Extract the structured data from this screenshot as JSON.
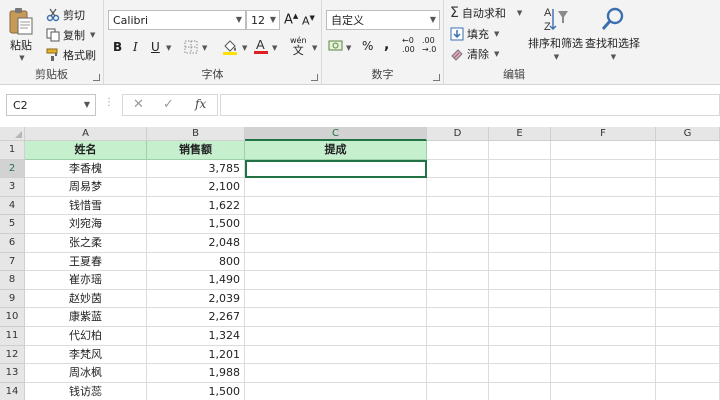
{
  "clipboard": {
    "group_label": "剪贴板",
    "paste_label": "粘贴",
    "cut_label": "剪切",
    "copy_label": "复制",
    "format_painter_label": "格式刷"
  },
  "font": {
    "group_label": "字体",
    "font_name": "Calibri",
    "font_size": "12",
    "bold": "B",
    "italic": "I",
    "underline": "U",
    "grow": "A",
    "shrink": "A",
    "phonetic_top": "wén",
    "phonetic_bottom": "文"
  },
  "number": {
    "group_label": "数字",
    "format": "自定义",
    "percent": "%",
    "comma": ",",
    "inc_decimal_top": "←0",
    "inc_decimal_bottom": ".00",
    "dec_decimal_top": ".00",
    "dec_decimal_bottom": "→.0"
  },
  "editing": {
    "group_label": "编辑",
    "autosum_label": "自动求和",
    "fill_label": "填充",
    "clear_label": "清除",
    "sort_filter_label": "排序和筛选",
    "find_select_label": "查找和选择"
  },
  "formula_bar": {
    "name_box": "C2",
    "cancel": "✕",
    "enter": "✓",
    "fx": "fx",
    "value": ""
  },
  "sheet": {
    "columns": [
      "A",
      "B",
      "C",
      "D",
      "E",
      "F",
      "G"
    ],
    "selected_column": "C",
    "selected_row": "2",
    "header_row": [
      "姓名",
      "销售额",
      "提成"
    ],
    "rows": [
      {
        "row": "2",
        "name": "李香槐",
        "sales": "3,785"
      },
      {
        "row": "3",
        "name": "周易梦",
        "sales": "2,100"
      },
      {
        "row": "4",
        "name": "钱惜雪",
        "sales": "1,622"
      },
      {
        "row": "5",
        "name": "刘宛海",
        "sales": "1,500"
      },
      {
        "row": "6",
        "name": "张之柔",
        "sales": "2,048"
      },
      {
        "row": "7",
        "name": "王夏春",
        "sales": "800"
      },
      {
        "row": "8",
        "name": "崔亦瑶",
        "sales": "1,490"
      },
      {
        "row": "9",
        "name": "赵妙茵",
        "sales": "2,039"
      },
      {
        "row": "10",
        "name": "康紫蓝",
        "sales": "2,267"
      },
      {
        "row": "11",
        "name": "代幻柏",
        "sales": "1,324"
      },
      {
        "row": "12",
        "name": "李梵风",
        "sales": "1,201"
      },
      {
        "row": "13",
        "name": "周冰枫",
        "sales": "1,988"
      },
      {
        "row": "14",
        "name": "钱访蕊",
        "sales": "1,500"
      }
    ]
  },
  "colors": {
    "header_fill": "#c6efce",
    "accent": "#217346"
  }
}
